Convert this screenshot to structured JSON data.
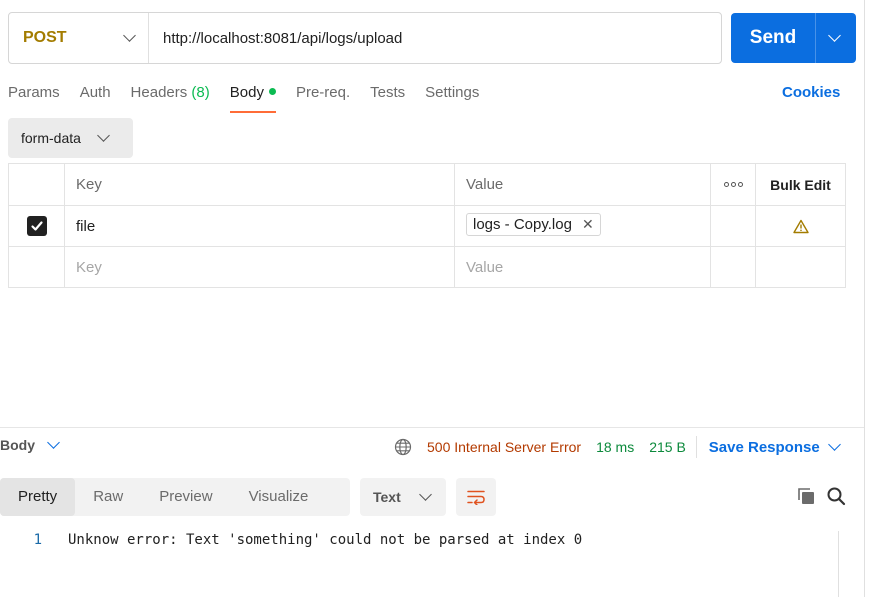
{
  "request": {
    "method": "POST",
    "url": "http://localhost:8081/api/logs/upload",
    "send_label": "Send"
  },
  "tabs": [
    {
      "label": "Params"
    },
    {
      "label": "Auth"
    },
    {
      "label": "Headers",
      "count": "(8)"
    },
    {
      "label": "Body",
      "active": true
    },
    {
      "label": "Pre-req."
    },
    {
      "label": "Tests"
    },
    {
      "label": "Settings"
    }
  ],
  "cookies_label": "Cookies",
  "body_mode": "form-data",
  "params_table": {
    "headers": {
      "key": "Key",
      "value": "Value",
      "bulk_edit": "Bulk Edit"
    },
    "rows": [
      {
        "checked": true,
        "key": "file",
        "value": "logs - Copy.log"
      }
    ],
    "placeholder": {
      "key": "Key",
      "value": "Value"
    }
  },
  "response": {
    "section_label": "Body",
    "status": "500 Internal Server Error",
    "time": "18 ms",
    "size": "215 B",
    "save_label": "Save Response",
    "view_tabs": [
      "Pretty",
      "Raw",
      "Preview",
      "Visualize"
    ],
    "active_view": "Pretty",
    "format": "Text",
    "lines": [
      {
        "number": "1",
        "text": "Unknow error: Text 'something' could not be parsed at index 0"
      }
    ]
  },
  "colors": {
    "accent_blue": "#0b6ee0",
    "method_post": "#a37c00",
    "tab_indicator": "#ff6c37",
    "status_error": "#b33a00",
    "success_green": "#0c8a3c"
  }
}
